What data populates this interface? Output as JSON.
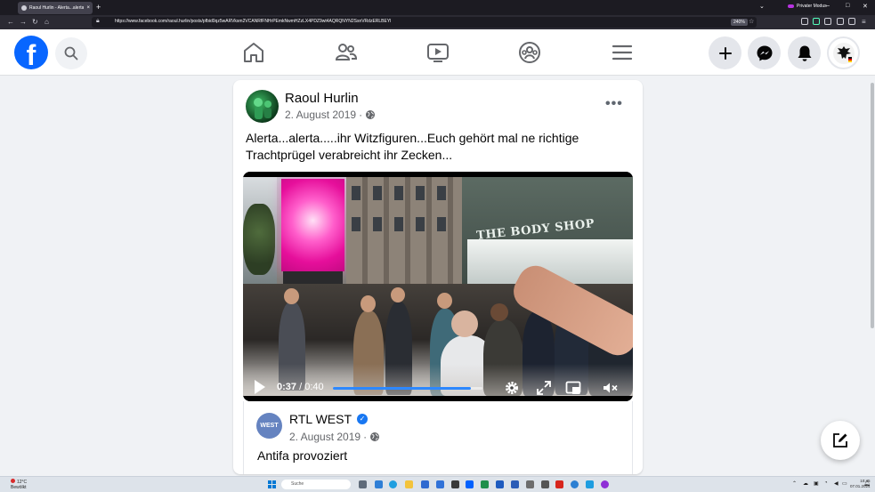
{
  "browser": {
    "tab_title": "Raoul Hurlin - Alerta...alerta.....",
    "tab_close": "×",
    "new_tab": "+",
    "tabs_menu": "⌄",
    "private_label": "Privater Modus",
    "url": "https://www.facebook.com/raoul.hurlin/posts/pfbid0qz5wARVksm2VCANRfFNHrPEmkNwmHZzLX4PDZ9wt4AQRQNYN2SsnVRdzERLBEYl",
    "zoom": "240%",
    "minimize": "–",
    "maximize": "□",
    "close": "✕"
  },
  "post": {
    "author": "Raoul Hurlin",
    "date": "2. August 2019",
    "separator": "·",
    "text": "Alerta...alerta.....ihr Witzfiguren...Euch gehört mal ne richtige Trachtprügel verabreicht ihr Zecken...",
    "more_label": "•••",
    "video": {
      "current_time": "0:37",
      "time_separator": " / ",
      "duration": "0:40",
      "progress_fraction": 0.925,
      "shop_sign": "THE BODY SHOP"
    },
    "shared": {
      "avatar_text": "WEST",
      "author": "RTL WEST",
      "verified_mark": "✓",
      "date": "2. August 2019",
      "text": "Antifa provoziert"
    }
  },
  "taskbar": {
    "temperature": "12°C",
    "weather": "Bewölkt",
    "search_placeholder": "Suche",
    "time": "10:45",
    "date": "07.01.2024"
  },
  "colors": {
    "facebook_blue": "#0866ff",
    "progress_blue": "#2d88ff",
    "verified_blue": "#1877f2"
  }
}
